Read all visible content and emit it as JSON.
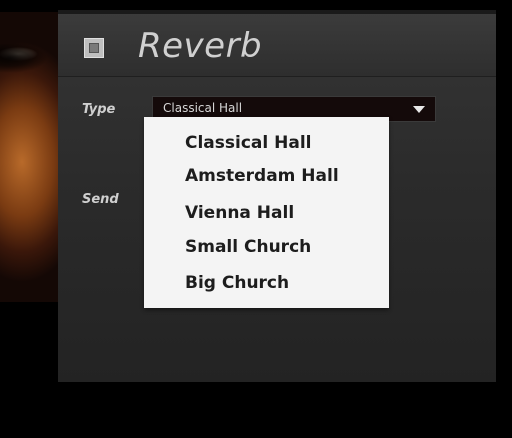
{
  "module": {
    "title": "Reverb",
    "power_icon": "power-toggle-icon"
  },
  "labels": {
    "type": "Type",
    "send": "Send"
  },
  "type_select": {
    "value": "Classical Hall",
    "arrow_icon": "chevron-down-icon",
    "options": [
      "Classical Hall",
      "Amsterdam Hall",
      "Vienna Hall",
      "Small Church",
      "Big Church"
    ]
  }
}
